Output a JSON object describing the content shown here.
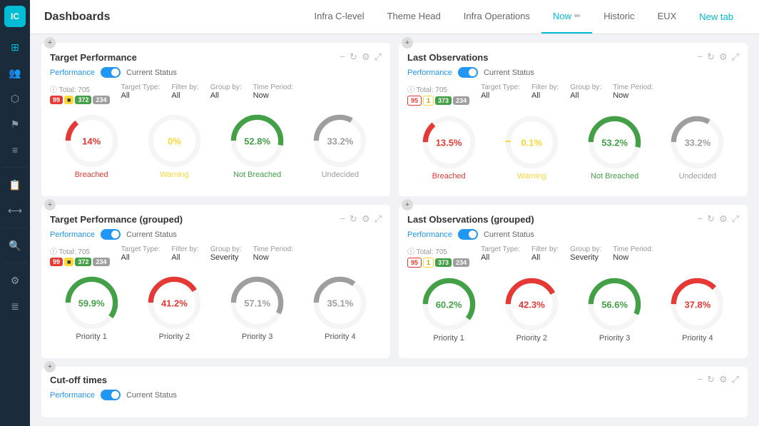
{
  "app": {
    "logo": "IC",
    "title": "Dashboards"
  },
  "tabs": [
    {
      "id": "infra-c",
      "label": "Infra C-level",
      "active": false
    },
    {
      "id": "theme-head",
      "label": "Theme Head",
      "active": false
    },
    {
      "id": "infra-ops",
      "label": "Infra Operations",
      "active": false
    },
    {
      "id": "now",
      "label": "Now",
      "active": true
    },
    {
      "id": "historic",
      "label": "Historic",
      "active": false
    },
    {
      "id": "eux",
      "label": "EUX",
      "active": false
    },
    {
      "id": "new-tab",
      "label": "New tab",
      "active": false
    }
  ],
  "sidebar_icons": [
    "⊞",
    "👥",
    "🔗",
    "⚑",
    "≡",
    "🔍",
    "⚙",
    "≣"
  ],
  "widgets": {
    "target_performance": {
      "title": "Target Performance",
      "perf_label": "Performance",
      "current_status_label": "Current Status",
      "total_label": "Total: 705",
      "target_type_label": "Target Type:",
      "target_type_value": "All",
      "filter_by_label": "Filter by:",
      "filter_by_value": "All",
      "group_by_label": "Group by:",
      "group_by_value": "All",
      "time_period_label": "Time Period:",
      "time_period_value": "Now",
      "badges": [
        "99",
        "372",
        "234"
      ],
      "charts": [
        {
          "label": "Breached",
          "value": "14%",
          "color_class": "color-breached",
          "segments": [
            {
              "pct": 14,
              "color": "#e53935"
            },
            {
              "pct": 86,
              "color": "#f5f5f5"
            }
          ]
        },
        {
          "label": "Warning",
          "value": "0%",
          "color_class": "color-warning",
          "segments": [
            {
              "pct": 0,
              "color": "#fdd835"
            },
            {
              "pct": 100,
              "color": "#f5f5f5"
            }
          ]
        },
        {
          "label": "Not Breached",
          "value": "52.8%",
          "color_class": "color-notbreached",
          "segments": [
            {
              "pct": 52.8,
              "color": "#43a047"
            },
            {
              "pct": 47.2,
              "color": "#f5f5f5"
            }
          ]
        },
        {
          "label": "Undecided",
          "value": "33.2%",
          "color_class": "color-undecided",
          "segments": [
            {
              "pct": 33.2,
              "color": "#9e9e9e"
            },
            {
              "pct": 66.8,
              "color": "#f5f5f5"
            }
          ]
        }
      ]
    },
    "last_observations": {
      "title": "Last Observations",
      "perf_label": "Performance",
      "current_status_label": "Current Status",
      "total_label": "Total: 705",
      "target_type_label": "Target Type:",
      "target_type_value": "All",
      "filter_by_label": "Filter by:",
      "filter_by_value": "All",
      "group_by_label": "Group by:",
      "group_by_value": "All",
      "time_period_label": "Time Period:",
      "time_period_value": "Now",
      "badges": [
        "95",
        "1",
        "373",
        "234"
      ],
      "charts": [
        {
          "label": "Breached",
          "value": "13.5%",
          "color_class": "color-breached",
          "segments": [
            {
              "pct": 13.5,
              "color": "#e53935"
            },
            {
              "pct": 86.5,
              "color": "#f5f5f5"
            }
          ]
        },
        {
          "label": "Warning",
          "value": "0.1%",
          "color_class": "color-warning",
          "segments": [
            {
              "pct": 0.1,
              "color": "#fdd835"
            },
            {
              "pct": 99.9,
              "color": "#f5f5f5"
            }
          ]
        },
        {
          "label": "Not Breached",
          "value": "53.2%",
          "color_class": "color-notbreached",
          "segments": [
            {
              "pct": 53.2,
              "color": "#43a047"
            },
            {
              "pct": 46.8,
              "color": "#f5f5f5"
            }
          ]
        },
        {
          "label": "Undecided",
          "value": "33.2%",
          "color_class": "color-undecided",
          "segments": [
            {
              "pct": 33.2,
              "color": "#9e9e9e"
            },
            {
              "pct": 66.8,
              "color": "#f5f5f5"
            }
          ]
        }
      ]
    },
    "target_performance_grouped": {
      "title": "Target Performance (grouped)",
      "perf_label": "Performance",
      "current_status_label": "Current Status",
      "total_label": "Total: 705",
      "target_type_label": "Target Type:",
      "target_type_value": "All",
      "filter_by_label": "Filter by:",
      "filter_by_value": "All",
      "group_by_label": "Group by:",
      "group_by_value": "Severity",
      "time_period_label": "Time Period:",
      "time_period_value": "Now",
      "badges": [
        "99",
        "372",
        "234"
      ],
      "charts": [
        {
          "label": "Priority 1",
          "value": "59.9%",
          "color_class": "color-notbreached",
          "segments": [
            {
              "pct": 59.9,
              "color": "#43a047"
            },
            {
              "pct": 40.1,
              "color": "#f5f5f5"
            }
          ]
        },
        {
          "label": "Priority 2",
          "value": "41.2%",
          "color_class": "color-breached",
          "segments": [
            {
              "pct": 41.2,
              "color": "#e53935"
            },
            {
              "pct": 58.8,
              "color": "#f5f5f5"
            }
          ]
        },
        {
          "label": "Priority 3",
          "value": "57.1%",
          "color_class": "color-notbreached",
          "segments": [
            {
              "pct": 57.1,
              "color": "#9e9e9e"
            },
            {
              "pct": 42.9,
              "color": "#f5f5f5"
            }
          ]
        },
        {
          "label": "Priority 4",
          "value": "35.1%",
          "color_class": "color-undecided",
          "segments": [
            {
              "pct": 35.1,
              "color": "#9e9e9e"
            },
            {
              "pct": 64.9,
              "color": "#f5f5f5"
            }
          ]
        }
      ]
    },
    "last_observations_grouped": {
      "title": "Last Observations (grouped)",
      "perf_label": "Performance",
      "current_status_label": "Current Status",
      "total_label": "Total: 705",
      "target_type_label": "Target Type:",
      "target_type_value": "All",
      "filter_by_label": "Filter by:",
      "filter_by_value": "All",
      "group_by_label": "Group by:",
      "group_by_value": "Severity",
      "time_period_label": "Time Period:",
      "time_period_value": "Now",
      "badges": [
        "95",
        "1",
        "373",
        "234"
      ],
      "charts": [
        {
          "label": "Priority 1",
          "value": "60.2%",
          "color_class": "color-notbreached",
          "segments": [
            {
              "pct": 60.2,
              "color": "#43a047"
            },
            {
              "pct": 39.8,
              "color": "#f5f5f5"
            }
          ]
        },
        {
          "label": "Priority 2",
          "value": "42.3%",
          "color_class": "color-breached",
          "segments": [
            {
              "pct": 42.3,
              "color": "#e53935"
            },
            {
              "pct": 57.7,
              "color": "#f5f5f5"
            }
          ]
        },
        {
          "label": "Priority 3",
          "value": "56.6%",
          "color_class": "color-notbreached",
          "segments": [
            {
              "pct": 56.6,
              "color": "#43a047"
            },
            {
              "pct": 43.4,
              "color": "#f5f5f5"
            }
          ]
        },
        {
          "label": "Priority 4",
          "value": "37.8%",
          "color_class": "color-undecided",
          "segments": [
            {
              "pct": 37.8,
              "color": "#e53935"
            },
            {
              "pct": 62.2,
              "color": "#f5f5f5"
            }
          ]
        }
      ]
    },
    "cut_off_times": {
      "title": "Cut-off times",
      "perf_label": "Performance",
      "current_status_label": "Current Status"
    }
  },
  "controls": {
    "minimize": "−",
    "refresh": "↻",
    "settings": "⚙",
    "expand": "⤢"
  }
}
